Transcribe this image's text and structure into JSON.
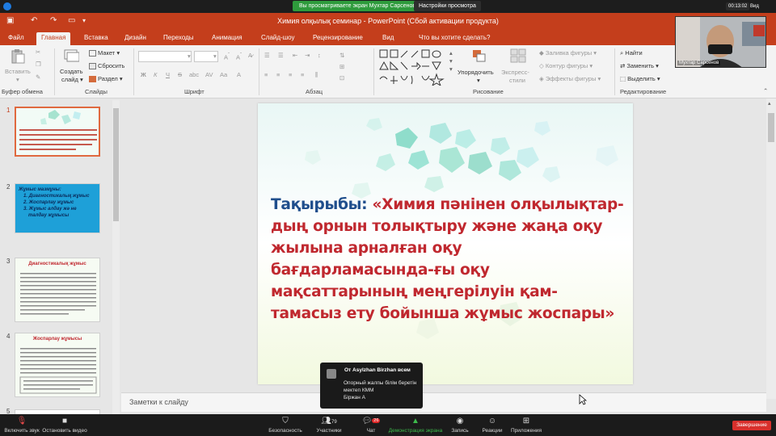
{
  "zoom_top": {
    "share_status": "Вы просматриваете экран Мухтар Сарсенов",
    "view_options": "Настройки просмотра",
    "timer": "00:13:02",
    "view_label": "Вид"
  },
  "window": {
    "title": "Химия олқылық семинар - PowerPoint (Сбой активации продукта)"
  },
  "tabs": [
    "Файл",
    "Главная",
    "Вставка",
    "Дизайн",
    "Переходы",
    "Анимация",
    "Слайд-шоу",
    "Рецензирование",
    "Вид",
    "Что вы хотите сделать?"
  ],
  "ribbon": {
    "clipboard": {
      "paste": "Вставить",
      "label": "Буфер обмена"
    },
    "slides": {
      "new_slide_1": "Создать",
      "new_slide_2": "слайд",
      "layout": "Макет",
      "reset": "Сбросить",
      "section": "Раздел",
      "label": "Слайды"
    },
    "font": {
      "bold": "Ж",
      "italic": "К",
      "underline": "Ч",
      "strike": "S",
      "label": "Шрифт"
    },
    "paragraph": {
      "label": "Абзац"
    },
    "drawing": {
      "arrange": "Упорядочить",
      "quick_styles_1": "Экспресс-",
      "quick_styles_2": "стили",
      "shape_fill": "Заливка фигуры",
      "shape_outline": "Контур фигуры",
      "shape_effects": "Эффекты фигуры",
      "label": "Рисование"
    },
    "editing": {
      "find": "Найти",
      "replace": "Заменить",
      "select": "Выделить",
      "label": "Редактирование"
    }
  },
  "slides": {
    "numbers": [
      "1",
      "2",
      "3",
      "4",
      "5"
    ],
    "thumb2_lines": [
      "Жұмыс мазмұны:",
      "1. Диагностикалық жұмыс",
      "2. Жоспарлау жұмыс",
      "3. Жұмыс алдау жә не",
      "талдау жұмысы"
    ],
    "thumb3_title": "Диагностикалық жұмыс",
    "thumb4_title": "Жоспарлау жұмысы"
  },
  "slide": {
    "title_label": "Тақырыбы:",
    "title_text": " «Химия пәнінен олқылықтар-дың орнын толықтыру және жаңа оқу жылына арналған оқу бағдарламасында-ғы оқу мақсаттарының меңгерілуін қам-тамасыз ету бойынша жұмыс жоспары»"
  },
  "notes": {
    "label": "Заметки к слайду"
  },
  "chat": {
    "from": "От Asylzhan Birzhan всем",
    "lines": [
      "Опорный жалпы білім беретін",
      "мектеп КММ",
      "Біржан А"
    ]
  },
  "video": {
    "name": "Мухтар Сарсенов"
  },
  "zoom_bottom": {
    "mute": "Включить звук",
    "video": "Остановить видео",
    "security": "Безопасность",
    "participants": "Участники",
    "participants_count": "79",
    "chat": "Чат",
    "chat_badge": "26",
    "share": "Демонстрация экрана",
    "record": "Запись",
    "reactions": "Реакции",
    "apps": "Приложения",
    "end": "Завершение"
  },
  "colors": {
    "accent": "#c43e1c",
    "title_blue": "#1f4e8c",
    "title_red": "#c0282f",
    "share_green": "#2e9b3c",
    "end_red": "#d9302c"
  }
}
